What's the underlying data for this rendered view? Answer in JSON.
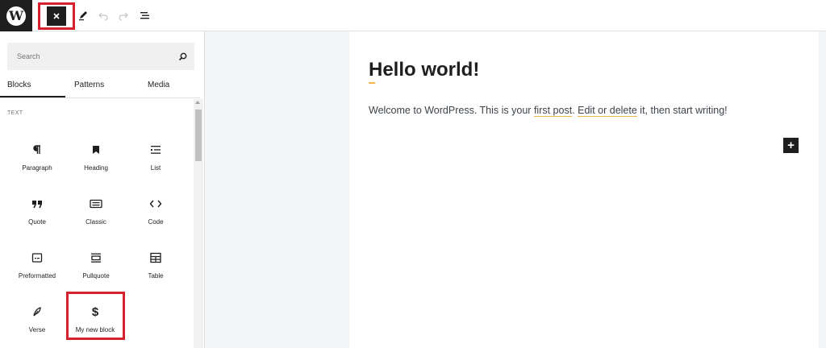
{
  "toolbar": {
    "toggle_icon": "close-icon",
    "tools": [
      "pencil-icon",
      "undo-icon",
      "redo-icon",
      "list-view-icon"
    ]
  },
  "inserter": {
    "search": {
      "placeholder": "Search"
    },
    "tabs": [
      {
        "label": "Blocks",
        "active": true
      },
      {
        "label": "Patterns",
        "active": false
      },
      {
        "label": "Media",
        "active": false
      }
    ],
    "category": "TEXT",
    "blocks": [
      {
        "label": "Paragraph",
        "icon": "paragraph-icon"
      },
      {
        "label": "Heading",
        "icon": "bookmark-icon"
      },
      {
        "label": "List",
        "icon": "list-icon"
      },
      {
        "label": "Quote",
        "icon": "quote-icon"
      },
      {
        "label": "Classic",
        "icon": "keyboard-icon"
      },
      {
        "label": "Code",
        "icon": "code-icon"
      },
      {
        "label": "Preformatted",
        "icon": "preformatted-icon"
      },
      {
        "label": "Pullquote",
        "icon": "pullquote-icon"
      },
      {
        "label": "Table",
        "icon": "table-icon"
      },
      {
        "label": "Verse",
        "icon": "feather-icon"
      },
      {
        "label": "My new block",
        "icon": "dollar-icon"
      }
    ]
  },
  "post": {
    "title": "Hello world!",
    "body_before": "Welcome to WordPress. This is your ",
    "body_link1": "first post",
    "body_mid": ". ",
    "body_link2": "Edit or delete",
    "body_after": " it, then start writing!"
  },
  "colors": {
    "highlight_box": "#d6202e",
    "dark": "#1e1e1e",
    "canvas_bg": "#f3f6f8",
    "accent_underline": "#f0b849"
  }
}
